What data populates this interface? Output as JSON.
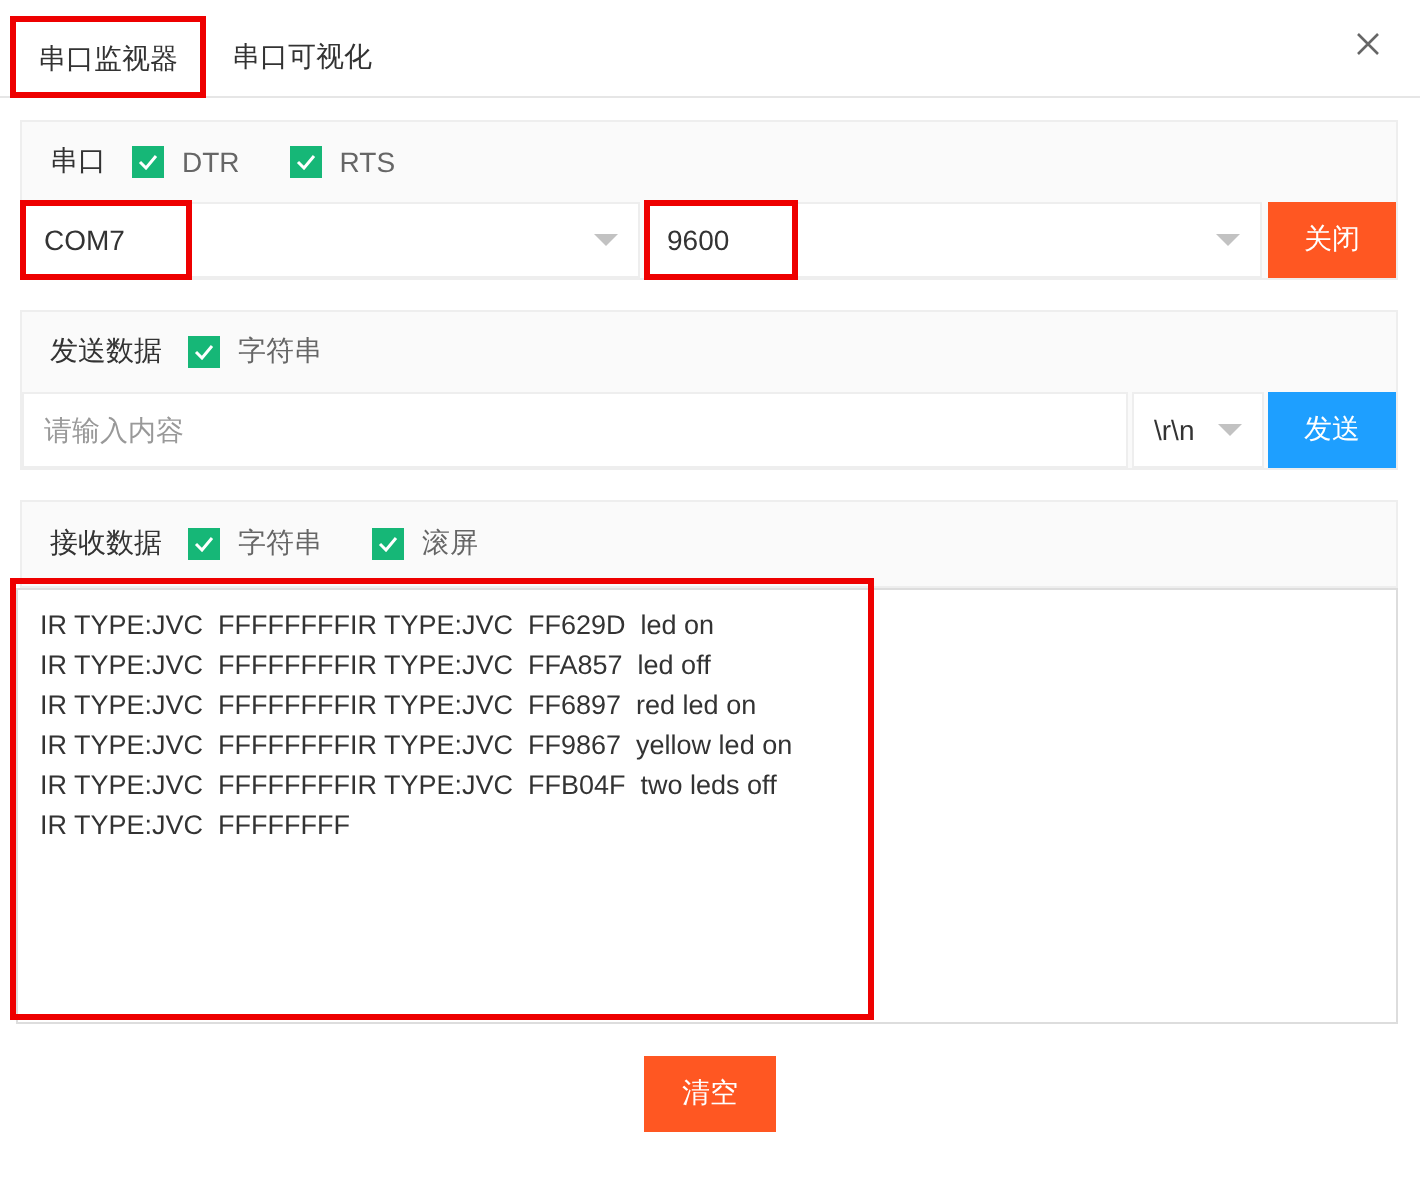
{
  "tabs": [
    {
      "label": "串口监视器",
      "selected": true,
      "highlighted": true
    },
    {
      "label": "串口可视化",
      "selected": false,
      "highlighted": false
    }
  ],
  "serial": {
    "label": "串口",
    "options": [
      {
        "label": "DTR",
        "checked": true
      },
      {
        "label": "RTS",
        "checked": true
      }
    ],
    "port": {
      "value": "COM7",
      "highlighted": true
    },
    "baud": {
      "value": "9600",
      "highlighted": true
    },
    "button": "关闭"
  },
  "send": {
    "label": "发送数据",
    "options": [
      {
        "label": "字符串",
        "checked": true
      }
    ],
    "placeholder": "请输入内容",
    "line_ending": "\\r\\n",
    "button": "发送"
  },
  "receive": {
    "label": "接收数据",
    "options": [
      {
        "label": "字符串",
        "checked": true
      },
      {
        "label": "滚屏",
        "checked": true
      }
    ],
    "highlighted": true,
    "lines": [
      "IR TYPE:JVC  FFFFFFFFIR TYPE:JVC  FF629D  led on",
      "IR TYPE:JVC  FFFFFFFFIR TYPE:JVC  FFA857  led off",
      "IR TYPE:JVC  FFFFFFFFIR TYPE:JVC  FF6897  red led on",
      "IR TYPE:JVC  FFFFFFFFIR TYPE:JVC  FF9867  yellow led on",
      "IR TYPE:JVC  FFFFFFFFIR TYPE:JVC  FFB04F  two leds off",
      "IR TYPE:JVC  FFFFFFFF"
    ]
  },
  "clear_button": "清空"
}
